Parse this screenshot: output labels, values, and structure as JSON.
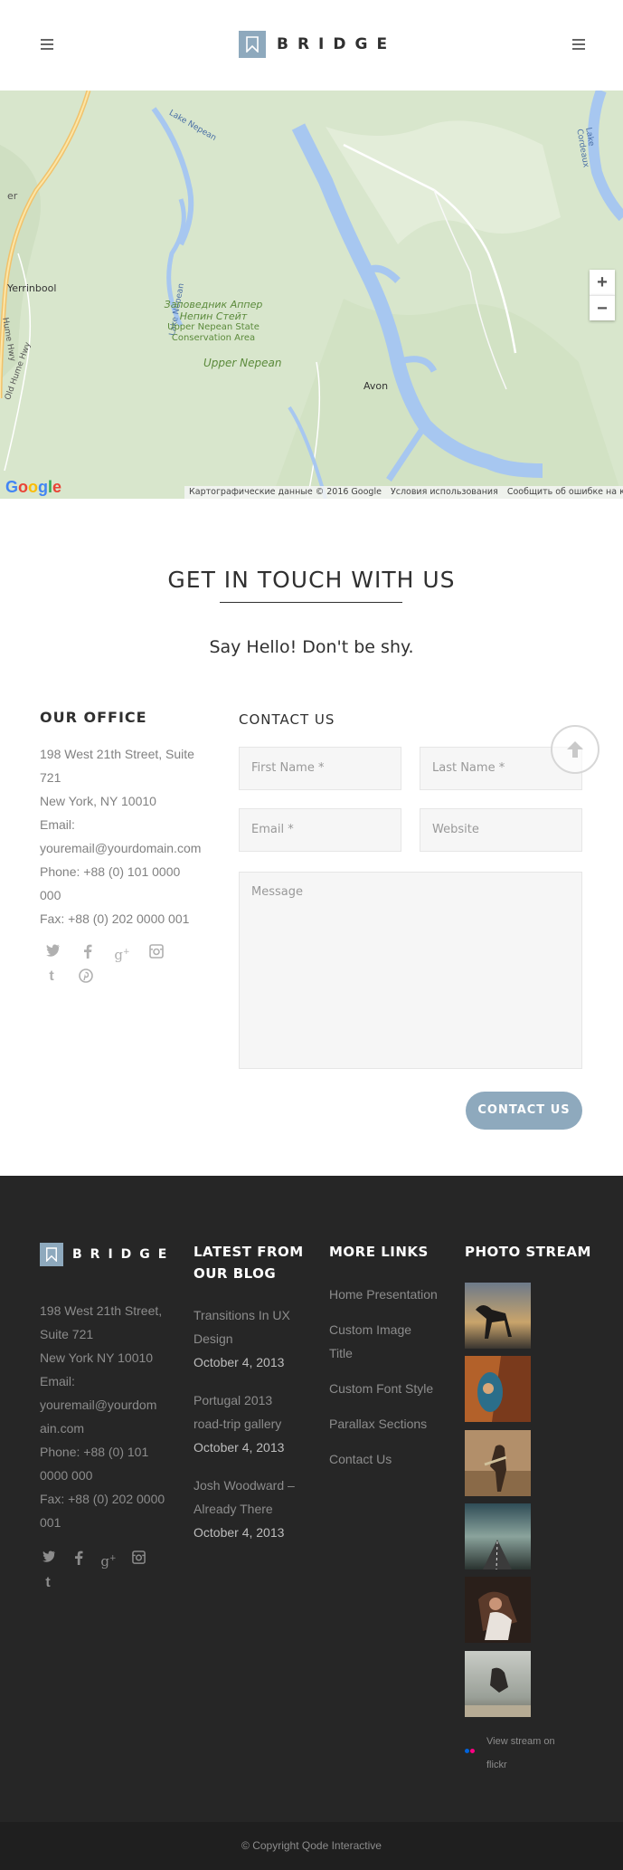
{
  "header": {
    "logo_text": "BRIDGE",
    "left_menu_icon": "hamburger-icon",
    "right_menu_icon": "hamburger-icon"
  },
  "map": {
    "labels": {
      "yerrinbool": "Yerrinbool",
      "reserve_ru_1": "Заповедник Аппер",
      "reserve_ru_2": "Непин Стейт",
      "reserve_en_1": "Upper Nepean State",
      "reserve_en_2": "Conservation Area",
      "upper_nepean": "Upper Nepean",
      "avon": "Avon",
      "lake_nepean": "Lake Nepean",
      "lake_cordeaux": "Lake Cordeaux",
      "hume_hwy": "Hume Hwy",
      "old_hume_hwy": "Old Hume Hwy",
      "edge_er": "er"
    },
    "zoom_in": "+",
    "zoom_out": "−",
    "google": "Google",
    "footer": {
      "data": "Картографические данные © 2016 Google",
      "terms": "Условия использования",
      "report": "Сообщить об ошибке на карте"
    }
  },
  "touch": {
    "title": "GET IN TOUCH WITH US",
    "subtitle": "Say Hello! Don't be shy."
  },
  "office": {
    "title": "OUR OFFICE",
    "lines": [
      "198  West 21th Street, Suite",
      "721",
      "New York, NY 10010",
      "Email:",
      "youremail@yourdomain.com",
      "Phone: +88 (0) 101 0000",
      "000",
      "Fax: +88 (0) 202 0000 001"
    ]
  },
  "contact": {
    "title": "CONTACT US",
    "first_name": "First Name *",
    "last_name": "Last Name *",
    "email": "Email *",
    "website": "Website",
    "message": "Message",
    "submit": "CONTACT US"
  },
  "footer": {
    "logo_text": "BRIDGE",
    "address_lines": [
      "198 West 21th Street,",
      "Suite 721",
      "New York NY 10010",
      "Email:",
      "youremail@yourdom",
      "ain.com",
      "Phone: +88 (0) 101",
      "0000 000",
      "Fax: +88 (0) 202 0000",
      "001"
    ],
    "blog_title_1": "LATEST FROM",
    "blog_title_2": "OUR BLOG",
    "blog": [
      {
        "title_1": "Transitions In UX",
        "title_2": "Design",
        "date": "October 4, 2013"
      },
      {
        "title_1": "Portugal 2013",
        "title_2": "road-trip gallery",
        "date": "October 4, 2013"
      },
      {
        "title_1": "Josh Woodward –",
        "title_2": "Already There",
        "date": "October 4, 2013"
      }
    ],
    "links_title": "MORE LINKS",
    "links": [
      "Home Presentation",
      "Custom Image",
      "Title",
      "Custom Font Style",
      "Parallax Sections",
      "Contact Us"
    ],
    "photo_title": "PHOTO STREAM",
    "flickr_1": "View stream on",
    "flickr_2": "flickr",
    "copyright": "© Copyright Qode Interactive"
  },
  "colors": {
    "accent": "#8ea9bd",
    "footer_bg": "#262626",
    "bottom_bg": "#1f1f1f",
    "map_land": "#d8e6cc",
    "map_water": "#a7c7f0"
  }
}
